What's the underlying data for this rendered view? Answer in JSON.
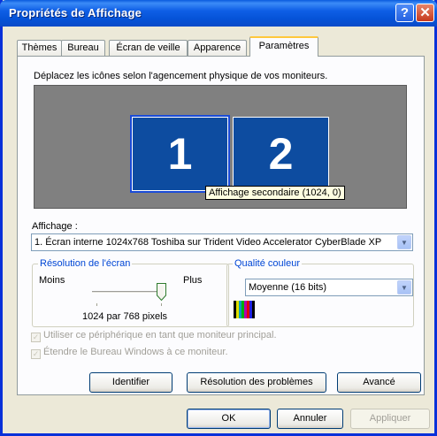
{
  "window": {
    "title": "Propriétés de Affichage",
    "help_label": "?",
    "close_label": "✕"
  },
  "tabs": [
    {
      "label": "Thèmes"
    },
    {
      "label": "Bureau"
    },
    {
      "label": "Écran de veille"
    },
    {
      "label": "Apparence"
    },
    {
      "label": "Paramètres",
      "active": true
    }
  ],
  "settings": {
    "description": "Déplacez les icônes selon l'agencement physique de vos moniteurs.",
    "monitors": [
      {
        "number": "1"
      },
      {
        "number": "2"
      }
    ],
    "tooltip": "Affichage secondaire (1024, 0)",
    "display_label": "Affichage :",
    "display_value": "1. Écran interne 1024x768 Toshiba sur Trident Video Accelerator CyberBlade XP",
    "resolution": {
      "group_title": "Résolution de l'écran",
      "less_label": "Moins",
      "more_label": "Plus",
      "value_text": "1024 par 768 pixels",
      "slider_level": 1.0
    },
    "color_quality": {
      "group_title": "Qualité couleur",
      "selected": "Moyenne (16 bits)"
    },
    "checkboxes": [
      {
        "label": "Utiliser ce périphérique en tant que moniteur principal.",
        "checked": true,
        "enabled": false
      },
      {
        "label": "Étendre le Bureau Windows à ce moniteur.",
        "checked": true,
        "enabled": false
      }
    ],
    "buttons": {
      "identify": "Identifier",
      "troubleshoot": "Résolution des problèmes",
      "advanced": "Avancé"
    }
  },
  "footer": {
    "ok": "OK",
    "cancel": "Annuler",
    "apply": "Appliquer"
  },
  "colors": {
    "accent": "#0831D9",
    "monitor": "#0D4CA0",
    "group_title": "#0046D5",
    "tab_highlight": "#FFC83C"
  }
}
